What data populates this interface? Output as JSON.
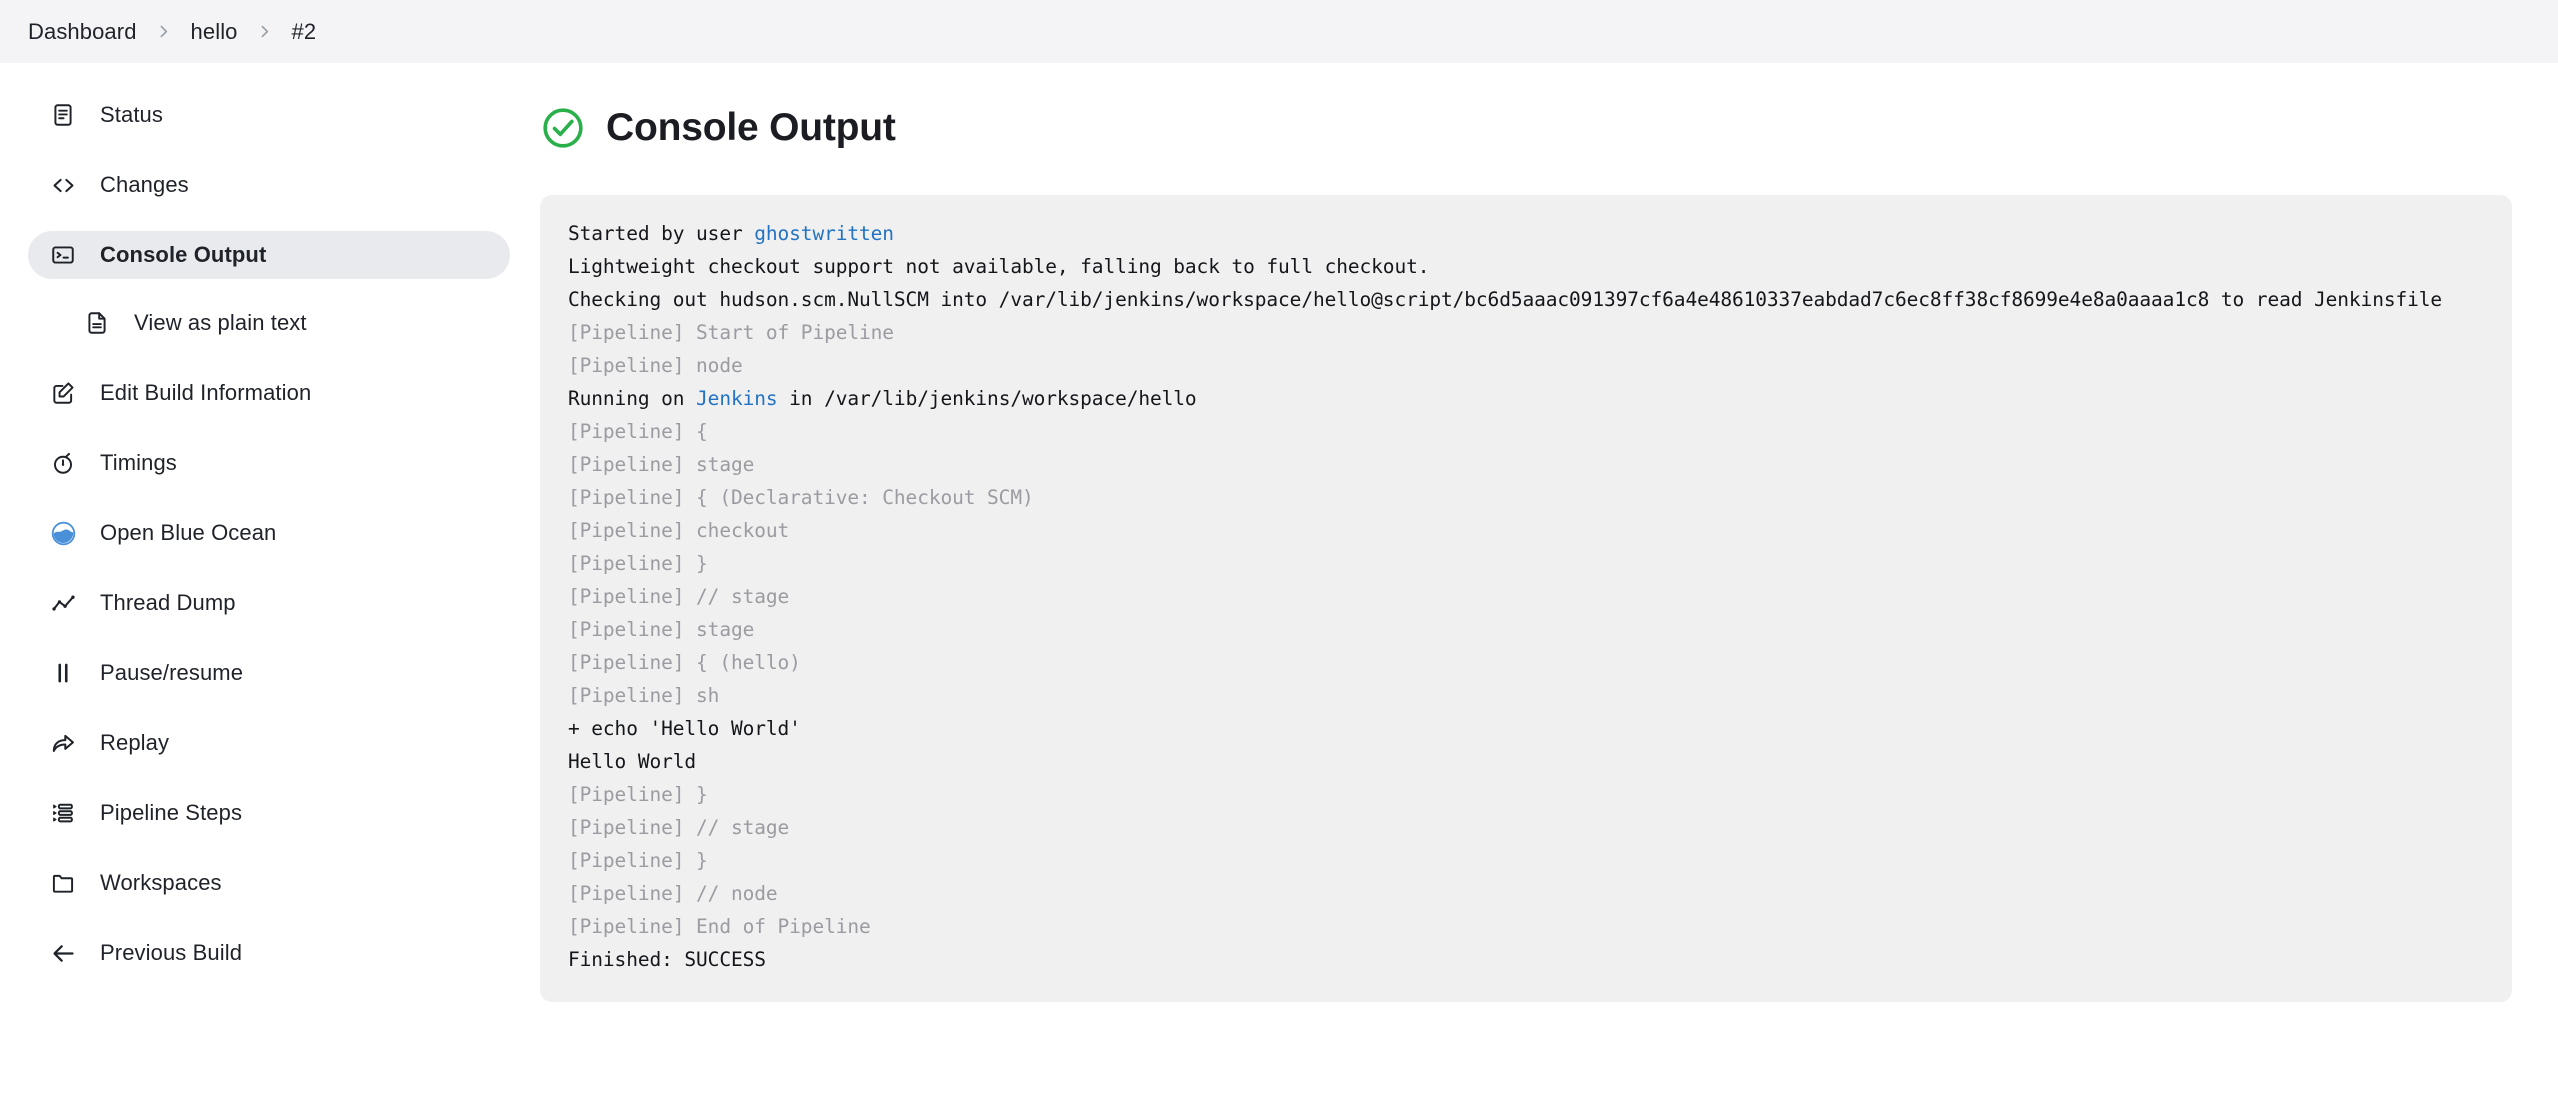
{
  "breadcrumb": {
    "items": [
      {
        "label": "Dashboard"
      },
      {
        "label": "hello"
      },
      {
        "label": "#2"
      }
    ],
    "separator_icon": "chevron-right-icon"
  },
  "sidebar": {
    "items": [
      {
        "label": "Status",
        "icon": "document-icon",
        "active": false,
        "sub": false
      },
      {
        "label": "Changes",
        "icon": "code-icon",
        "active": false,
        "sub": false
      },
      {
        "label": "Console Output",
        "icon": "terminal-icon",
        "active": true,
        "sub": false
      },
      {
        "label": "View as plain text",
        "icon": "plain-text-file-icon",
        "active": false,
        "sub": true
      },
      {
        "label": "Edit Build Information",
        "icon": "edit-square-icon",
        "active": false,
        "sub": false
      },
      {
        "label": "Timings",
        "icon": "stopwatch-icon",
        "active": false,
        "sub": false
      },
      {
        "label": "Open Blue Ocean",
        "icon": "blue-ocean-icon",
        "active": false,
        "sub": false
      },
      {
        "label": "Thread Dump",
        "icon": "line-chart-icon",
        "active": false,
        "sub": false
      },
      {
        "label": "Pause/resume",
        "icon": "pause-icon",
        "active": false,
        "sub": false
      },
      {
        "label": "Replay",
        "icon": "replay-arrow-icon",
        "active": false,
        "sub": false
      },
      {
        "label": "Pipeline Steps",
        "icon": "list-steps-icon",
        "active": false,
        "sub": false
      },
      {
        "label": "Workspaces",
        "icon": "folder-icon",
        "active": false,
        "sub": false
      },
      {
        "label": "Previous Build",
        "icon": "arrow-left-icon",
        "active": false,
        "sub": false
      }
    ]
  },
  "main": {
    "title": "Console Output",
    "status_icon": "check-circle-icon",
    "status_color": "#2ab04a"
  },
  "console": {
    "link_color": "#2273c4",
    "dim_color": "#9b9ba1",
    "lines": [
      {
        "dim": false,
        "segments": [
          {
            "text": "Started by user "
          },
          {
            "text": "ghostwritten",
            "link": true
          }
        ]
      },
      {
        "dim": false,
        "segments": [
          {
            "text": "Lightweight checkout support not available, falling back to full checkout."
          }
        ]
      },
      {
        "dim": false,
        "segments": [
          {
            "text": "Checking out hudson.scm.NullSCM into /var/lib/jenkins/workspace/hello@script/bc6d5aaac091397cf6a4e48610337eabdad7c6ec8ff38cf8699e4e8a0aaaa1c8 to read Jenkinsfile"
          }
        ]
      },
      {
        "dim": true,
        "segments": [
          {
            "text": "[Pipeline] Start of Pipeline"
          }
        ]
      },
      {
        "dim": true,
        "segments": [
          {
            "text": "[Pipeline] node"
          }
        ]
      },
      {
        "dim": false,
        "segments": [
          {
            "text": "Running on "
          },
          {
            "text": "Jenkins",
            "link": true
          },
          {
            "text": " in /var/lib/jenkins/workspace/hello"
          }
        ]
      },
      {
        "dim": true,
        "segments": [
          {
            "text": "[Pipeline] {"
          }
        ]
      },
      {
        "dim": true,
        "segments": [
          {
            "text": "[Pipeline] stage"
          }
        ]
      },
      {
        "dim": true,
        "segments": [
          {
            "text": "[Pipeline] { (Declarative: Checkout SCM)"
          }
        ]
      },
      {
        "dim": true,
        "segments": [
          {
            "text": "[Pipeline] checkout"
          }
        ]
      },
      {
        "dim": true,
        "segments": [
          {
            "text": "[Pipeline] }"
          }
        ]
      },
      {
        "dim": true,
        "segments": [
          {
            "text": "[Pipeline] // stage"
          }
        ]
      },
      {
        "dim": true,
        "segments": [
          {
            "text": "[Pipeline] stage"
          }
        ]
      },
      {
        "dim": true,
        "segments": [
          {
            "text": "[Pipeline] { (hello)"
          }
        ]
      },
      {
        "dim": true,
        "segments": [
          {
            "text": "[Pipeline] sh"
          }
        ]
      },
      {
        "dim": false,
        "segments": [
          {
            "text": "+ echo 'Hello World'"
          }
        ]
      },
      {
        "dim": false,
        "segments": [
          {
            "text": "Hello World"
          }
        ]
      },
      {
        "dim": true,
        "segments": [
          {
            "text": "[Pipeline] }"
          }
        ]
      },
      {
        "dim": true,
        "segments": [
          {
            "text": "[Pipeline] // stage"
          }
        ]
      },
      {
        "dim": true,
        "segments": [
          {
            "text": "[Pipeline] }"
          }
        ]
      },
      {
        "dim": true,
        "segments": [
          {
            "text": "[Pipeline] // node"
          }
        ]
      },
      {
        "dim": true,
        "segments": [
          {
            "text": "[Pipeline] End of Pipeline"
          }
        ]
      },
      {
        "dim": false,
        "segments": [
          {
            "text": "Finished: SUCCESS"
          }
        ]
      }
    ]
  }
}
